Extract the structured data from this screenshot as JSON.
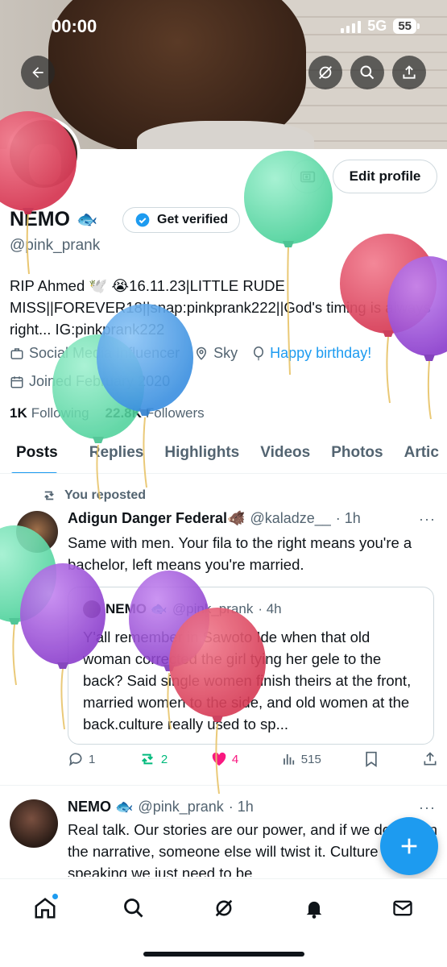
{
  "status_bar": {
    "time": "00:00",
    "network": "5G",
    "battery": "55"
  },
  "profile": {
    "name": "NEMO",
    "name_emoji": "🐟",
    "get_verified_label": "Get verified",
    "handle": "@pink_prank",
    "edit_profile_label": "Edit profile",
    "bio": "RIP Ahmed 🕊️ 😭16.11.23|LITTLE RUDE MISS||FOREVER18||snap:pinkprank222||God's timing is always right... IG:pinkprank222",
    "category": "Social Media Influencer",
    "location": "Sky",
    "birthday": "Happy birthday!",
    "joined": "Joined February 2020",
    "following_count": "1K",
    "following_label": "Following",
    "followers_count": "22.8K",
    "followers_label": "Followers"
  },
  "tabs": [
    "Posts",
    "Replies",
    "Highlights",
    "Videos",
    "Photos",
    "Artic"
  ],
  "repost_note": "You reposted",
  "post1": {
    "author": "Adigun Danger Federal🐗",
    "handle": "@kaladze__",
    "time": "· 1h",
    "text": "Same with men. Your fila to the right means you're a bachelor, left means you're married.",
    "quote": {
      "author": "NEMO 🐟",
      "handle": "@pink_prank",
      "time": "· 4h",
      "text": "Y'all remember in Sawoto Ide when that old woman corrected the girl tying her gele to the back? Said single women finish theirs at the front, married women to the side, and old women at the back.culture really used to sp..."
    },
    "replies": "1",
    "reposts": "2",
    "likes": "4",
    "views": "515"
  },
  "post2": {
    "author": "NEMO 🐟",
    "handle": "@pink_prank",
    "time": "· 1h",
    "text": "Real talk. Our stories are our power, and if we don't own the narrative, someone else will twist it. Culture is still speaking.we just need to be"
  },
  "more_label": "···",
  "colors": {
    "accent": "#1d9bf0",
    "repost": "#00ba7c",
    "like": "#f91880",
    "balloon_red": "#e04a63",
    "balloon_green": "#5fdca8",
    "balloon_purple": "#9b4fd6",
    "balloon_blue": "#4da0ea"
  },
  "icons": [
    "back-arrow-icon",
    "grok-icon",
    "search-icon",
    "share-icon",
    "camera-icon",
    "verified-badge-icon",
    "briefcase-icon",
    "location-icon",
    "balloon-icon",
    "calendar-icon",
    "repost-icon",
    "reply-icon",
    "like-icon",
    "views-icon",
    "bookmark-icon",
    "compose-icon",
    "home-icon",
    "notifications-icon",
    "messages-icon"
  ]
}
